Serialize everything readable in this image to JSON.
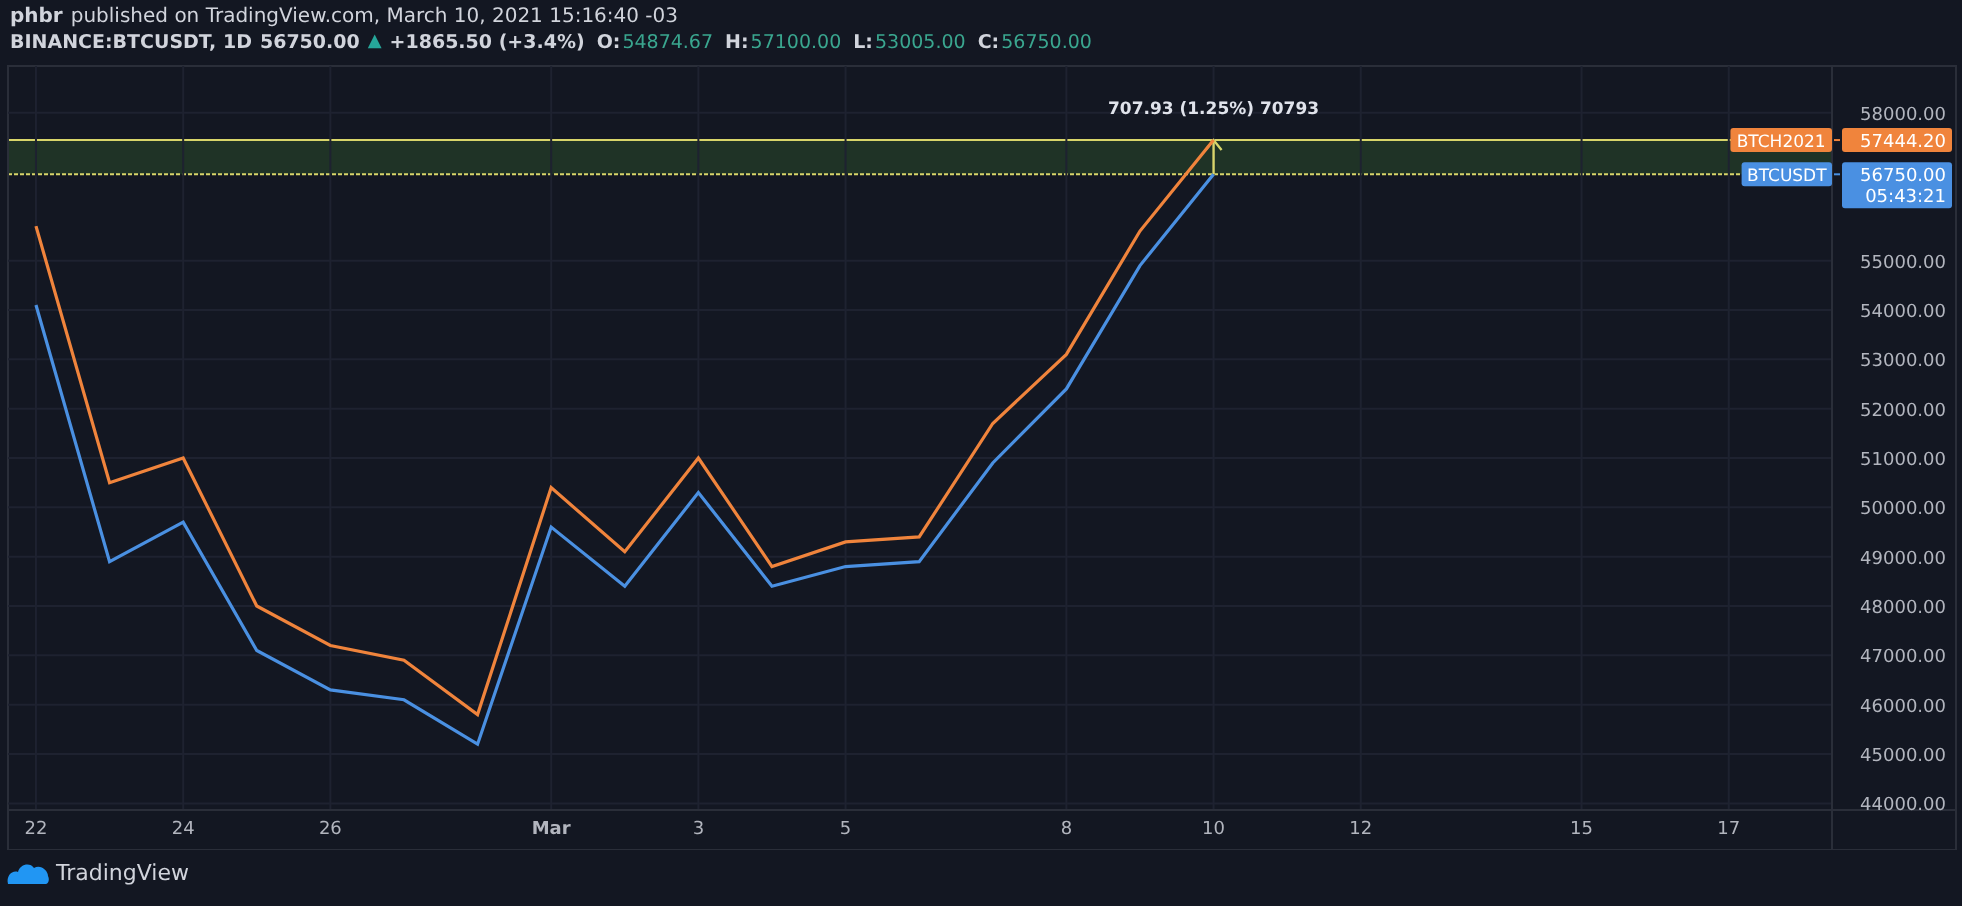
{
  "header": {
    "publisher": "phbr",
    "published": "published on TradingView.com, March 10, 2021 15:16:40 -03"
  },
  "legend": {
    "symbol": "BINANCE:BTCUSDT, 1D",
    "price": "56750.00",
    "arrow": "▲",
    "change": "+1865.50 (+3.4%)",
    "ohlc": [
      {
        "label": "O:",
        "value": "54874.67"
      },
      {
        "label": "H:",
        "value": "57100.00"
      },
      {
        "label": "L:",
        "value": "53005.00"
      },
      {
        "label": "C:",
        "value": "56750.00"
      }
    ]
  },
  "chart": {
    "chart_data": {
      "type": "line",
      "categories": [
        "22",
        null,
        "24",
        null,
        "26",
        null,
        null,
        "Mar",
        null,
        "3",
        null,
        "5",
        null,
        null,
        "8",
        null,
        "10",
        null,
        "12",
        null,
        null,
        "15",
        null,
        "17",
        null
      ],
      "series": [
        {
          "name": "BTCH2021",
          "color": "#f0843c",
          "values": [
            55700,
            50500,
            51000,
            48000,
            47200,
            46900,
            45800,
            50400,
            49100,
            51000,
            48800,
            49300,
            49400,
            51700,
            53100,
            55600,
            57444.2,
            null,
            null,
            null,
            null,
            null,
            null,
            null,
            null
          ]
        },
        {
          "name": "BTCUSDT",
          "color": "#4a90e2",
          "values": [
            54100,
            48900,
            49700,
            47100,
            46300,
            46100,
            45200,
            49600,
            48400,
            50300,
            48400,
            48800,
            48900,
            50900,
            52400,
            54900,
            56750,
            null,
            null,
            null,
            null,
            null,
            null,
            null,
            null
          ]
        }
      ],
      "ylim": [
        43866,
        58945
      ],
      "grid": true,
      "yticks": [
        {
          "value": 44000,
          "label": "44000.00"
        },
        {
          "value": 45000,
          "label": "45000.00"
        },
        {
          "value": 46000,
          "label": "46000.00"
        },
        {
          "value": 47000,
          "label": "47000.00"
        },
        {
          "value": 48000,
          "label": "48000.00"
        },
        {
          "value": 49000,
          "label": "49000.00"
        },
        {
          "value": 50000,
          "label": "50000.00"
        },
        {
          "value": 51000,
          "label": "51000.00"
        },
        {
          "value": 52000,
          "label": "52000.00"
        },
        {
          "value": 53000,
          "label": "53000.00"
        },
        {
          "value": 54000,
          "label": "54000.00"
        },
        {
          "value": 55000,
          "label": "55000.00"
        },
        {
          "value": 58000,
          "label": "58000.00"
        }
      ],
      "annotations": [
        {
          "text": "707.93 (1.25%) 70793",
          "x": "10",
          "y": 57444.2
        }
      ]
    },
    "price_tags": [
      {
        "value": "57444.20"
      },
      {
        "value": "56750.00",
        "countdown": "05:43:21"
      }
    ]
  },
  "footer": {
    "brand": "TradingView"
  }
}
